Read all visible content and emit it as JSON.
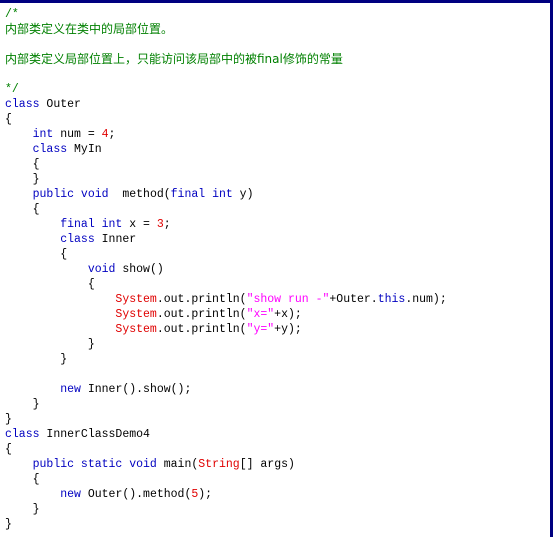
{
  "window": {
    "kind": "source-code-viewer",
    "language": "Java",
    "border_color": "#000080",
    "background_color": "#ffffff"
  },
  "theme": {
    "comment_color": "#008000",
    "keyword_color": "#0000C0",
    "type_color": "#E00000",
    "string_color": "#FF00FF",
    "number_color": "#E00000",
    "text_color": "#000000"
  },
  "code": {
    "lines": [
      {
        "n": 1,
        "tokens": [
          {
            "t": "/*",
            "c": "comment"
          }
        ]
      },
      {
        "n": 2,
        "cjk": true,
        "tokens": [
          {
            "t": "内部类定义在类中的局部位置。",
            "c": "comment"
          }
        ]
      },
      {
        "n": 3,
        "tokens": [
          {
            "t": "",
            "c": "plain"
          }
        ]
      },
      {
        "n": 4,
        "cjk": true,
        "tokens": [
          {
            "t": "内部类定义局部位置上，只能访问该局部中的被final修饰的常量",
            "c": "comment"
          }
        ]
      },
      {
        "n": 5,
        "tokens": [
          {
            "t": "",
            "c": "plain"
          }
        ]
      },
      {
        "n": 6,
        "tokens": [
          {
            "t": "*/",
            "c": "comment"
          }
        ]
      },
      {
        "n": 7,
        "tokens": [
          {
            "t": "class",
            "c": "keyword"
          },
          {
            "t": " Outer",
            "c": "plain"
          }
        ]
      },
      {
        "n": 8,
        "tokens": [
          {
            "t": "{",
            "c": "punct"
          }
        ]
      },
      {
        "n": 9,
        "tokens": [
          {
            "t": "    ",
            "c": "plain"
          },
          {
            "t": "int",
            "c": "keyword"
          },
          {
            "t": " num = ",
            "c": "plain"
          },
          {
            "t": "4",
            "c": "number"
          },
          {
            "t": ";",
            "c": "punct"
          }
        ]
      },
      {
        "n": 10,
        "tokens": [
          {
            "t": "    ",
            "c": "plain"
          },
          {
            "t": "class",
            "c": "keyword"
          },
          {
            "t": " MyIn",
            "c": "plain"
          }
        ]
      },
      {
        "n": 11,
        "tokens": [
          {
            "t": "    {",
            "c": "punct"
          }
        ]
      },
      {
        "n": 12,
        "tokens": [
          {
            "t": "    }",
            "c": "punct"
          }
        ]
      },
      {
        "n": 13,
        "tokens": [
          {
            "t": "    ",
            "c": "plain"
          },
          {
            "t": "public void",
            "c": "keyword"
          },
          {
            "t": "  method(",
            "c": "plain"
          },
          {
            "t": "final int",
            "c": "keyword"
          },
          {
            "t": " y)",
            "c": "plain"
          }
        ]
      },
      {
        "n": 14,
        "tokens": [
          {
            "t": "    {",
            "c": "punct"
          }
        ]
      },
      {
        "n": 15,
        "tokens": [
          {
            "t": "        ",
            "c": "plain"
          },
          {
            "t": "final int",
            "c": "keyword"
          },
          {
            "t": " x = ",
            "c": "plain"
          },
          {
            "t": "3",
            "c": "number"
          },
          {
            "t": ";",
            "c": "punct"
          }
        ]
      },
      {
        "n": 16,
        "tokens": [
          {
            "t": "        ",
            "c": "plain"
          },
          {
            "t": "class",
            "c": "keyword"
          },
          {
            "t": " Inner",
            "c": "plain"
          }
        ]
      },
      {
        "n": 17,
        "tokens": [
          {
            "t": "        {",
            "c": "punct"
          }
        ]
      },
      {
        "n": 18,
        "tokens": [
          {
            "t": "            ",
            "c": "plain"
          },
          {
            "t": "void",
            "c": "keyword"
          },
          {
            "t": " show()",
            "c": "plain"
          }
        ]
      },
      {
        "n": 19,
        "tokens": [
          {
            "t": "            {",
            "c": "punct"
          }
        ]
      },
      {
        "n": 20,
        "tokens": [
          {
            "t": "                ",
            "c": "plain"
          },
          {
            "t": "System",
            "c": "type"
          },
          {
            "t": ".out.println(",
            "c": "plain"
          },
          {
            "t": "\"show run -\"",
            "c": "string"
          },
          {
            "t": "+Outer.",
            "c": "plain"
          },
          {
            "t": "this",
            "c": "keyword"
          },
          {
            "t": ".num);",
            "c": "plain"
          }
        ]
      },
      {
        "n": 21,
        "tokens": [
          {
            "t": "                ",
            "c": "plain"
          },
          {
            "t": "System",
            "c": "type"
          },
          {
            "t": ".out.println(",
            "c": "plain"
          },
          {
            "t": "\"x=\"",
            "c": "string"
          },
          {
            "t": "+x);",
            "c": "plain"
          }
        ]
      },
      {
        "n": 22,
        "tokens": [
          {
            "t": "                ",
            "c": "plain"
          },
          {
            "t": "System",
            "c": "type"
          },
          {
            "t": ".out.println(",
            "c": "plain"
          },
          {
            "t": "\"y=\"",
            "c": "string"
          },
          {
            "t": "+y);",
            "c": "plain"
          }
        ]
      },
      {
        "n": 23,
        "tokens": [
          {
            "t": "            }",
            "c": "punct"
          }
        ]
      },
      {
        "n": 24,
        "tokens": [
          {
            "t": "        }",
            "c": "punct"
          }
        ]
      },
      {
        "n": 25,
        "tokens": [
          {
            "t": "",
            "c": "plain"
          }
        ]
      },
      {
        "n": 26,
        "tokens": [
          {
            "t": "        ",
            "c": "plain"
          },
          {
            "t": "new",
            "c": "keyword"
          },
          {
            "t": " Inner().show();",
            "c": "plain"
          }
        ]
      },
      {
        "n": 27,
        "tokens": [
          {
            "t": "    }",
            "c": "punct"
          }
        ]
      },
      {
        "n": 28,
        "tokens": [
          {
            "t": "}",
            "c": "punct"
          }
        ]
      },
      {
        "n": 29,
        "tokens": [
          {
            "t": "class",
            "c": "keyword"
          },
          {
            "t": " InnerClassDemo4",
            "c": "plain"
          }
        ]
      },
      {
        "n": 30,
        "tokens": [
          {
            "t": "{",
            "c": "punct"
          }
        ]
      },
      {
        "n": 31,
        "tokens": [
          {
            "t": "    ",
            "c": "plain"
          },
          {
            "t": "public static void",
            "c": "keyword"
          },
          {
            "t": " main(",
            "c": "plain"
          },
          {
            "t": "String",
            "c": "type"
          },
          {
            "t": "[] args)",
            "c": "plain"
          }
        ]
      },
      {
        "n": 32,
        "tokens": [
          {
            "t": "    {",
            "c": "punct"
          }
        ]
      },
      {
        "n": 33,
        "tokens": [
          {
            "t": "        ",
            "c": "plain"
          },
          {
            "t": "new",
            "c": "keyword"
          },
          {
            "t": " Outer().method(",
            "c": "plain"
          },
          {
            "t": "5",
            "c": "number"
          },
          {
            "t": ");",
            "c": "plain"
          }
        ]
      },
      {
        "n": 34,
        "tokens": [
          {
            "t": "    }",
            "c": "punct"
          }
        ]
      },
      {
        "n": 35,
        "tokens": [
          {
            "t": "}",
            "c": "punct"
          }
        ]
      }
    ]
  }
}
